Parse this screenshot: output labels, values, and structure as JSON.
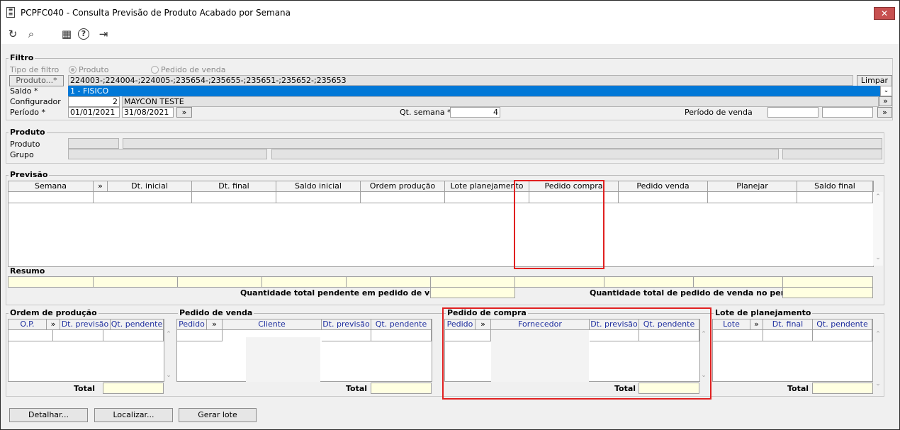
{
  "window": {
    "title": "PCPFC040 - Consulta Previsão de Produto Acabado por Semana",
    "close": "✕"
  },
  "toolbar": {
    "refresh": "↻",
    "search": "⌕",
    "calendar": "▦",
    "help": "?",
    "exit": "⇥"
  },
  "filtro": {
    "title": "Filtro",
    "tipo_label": "Tipo de filtro",
    "opt_produto": "Produto",
    "opt_pedido": "Pedido de venda",
    "produto_btn": "Produto...*",
    "produto_value": "224003-;224004-;224005-;235654-;235655-;235651-;235652-;235653",
    "limpar": "Limpar",
    "saldo_label": "Saldo *",
    "saldo_value": "1 - FISICO",
    "config_label": "Configurador",
    "config_code": "2",
    "config_name": "MAYCON TESTE",
    "periodo_label": "Período *",
    "periodo_ini": "01/01/2021",
    "periodo_fim": "31/08/2021",
    "qt_semana_label": "Qt. semana *",
    "qt_semana": "4",
    "periodo_venda_label": "Período de venda",
    "more": "»"
  },
  "produto": {
    "title": "Produto",
    "produto_label": "Produto",
    "grupo_label": "Grupo"
  },
  "previsao": {
    "title": "Previsão",
    "columns": [
      "Semana",
      "»",
      "Dt. inicial",
      "Dt. final",
      "Saldo inicial",
      "Ordem produção",
      "Lote planejamento",
      "Pedido compra",
      "Pedido venda",
      "Planejar",
      "Saldo final"
    ]
  },
  "resumo": {
    "title": "Resumo",
    "qt_pendente_label": "Quantidade total pendente em pedido de venda",
    "qt_periodo_label": "Quantidade total de pedido de venda no período"
  },
  "ordem": {
    "title": "Ordem de produção",
    "columns": [
      "O.P.",
      "»",
      "Dt. previsão",
      "Qt. pendente"
    ],
    "total": "Total"
  },
  "pvenda": {
    "title": "Pedido de venda",
    "columns": [
      "Pedido",
      "»",
      "Cliente",
      "Dt. previsão",
      "Qt. pendente"
    ],
    "total": "Total"
  },
  "pcompra": {
    "title": "Pedido de compra",
    "columns": [
      "Pedido",
      "»",
      "Fornecedor",
      "Dt. previsão",
      "Qt. pendente"
    ],
    "total": "Total"
  },
  "lote": {
    "title": "Lote de planejamento",
    "columns": [
      "Lote",
      "»",
      "Dt. final",
      "Qt. pendente"
    ],
    "total": "Total"
  },
  "buttons": {
    "detalhar": "Detalhar...",
    "localizar": "Localizar...",
    "gerar": "Gerar lote"
  }
}
